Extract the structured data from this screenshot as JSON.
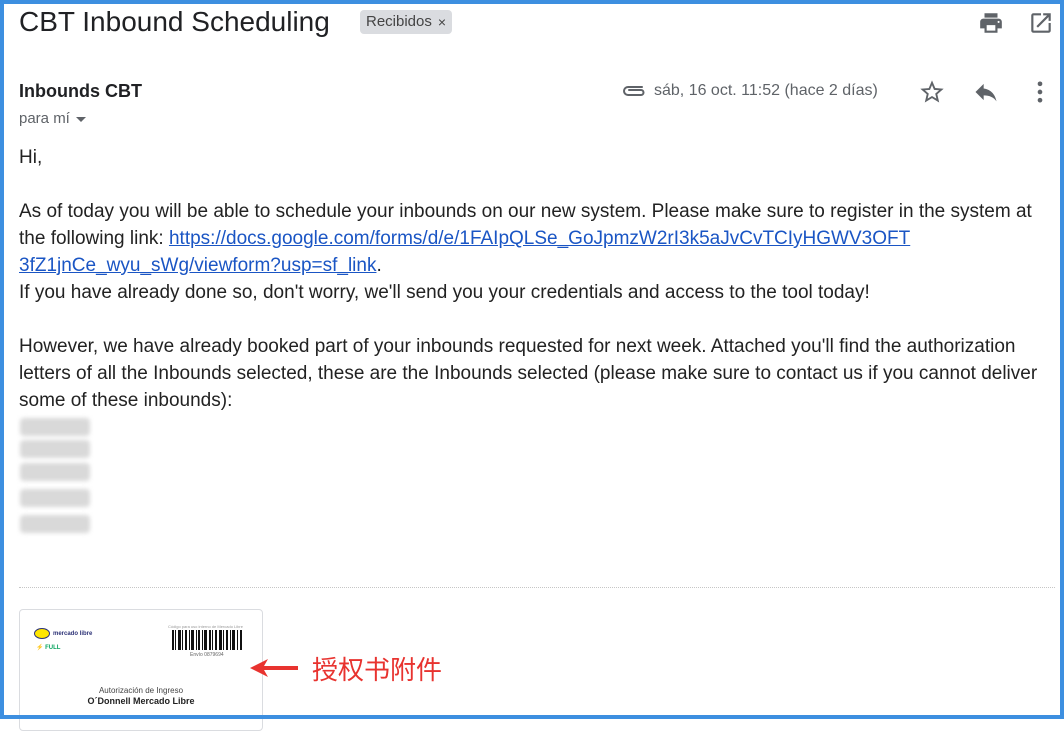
{
  "email": {
    "subject": "CBT Inbound Scheduling",
    "label_chip": "Recibidos",
    "label_chip_close": "×",
    "sender": "Inbounds CBT",
    "recipient": "para mí",
    "date": "sáb, 16 oct. 11:52 (hace 2 días)"
  },
  "body": {
    "greeting": "Hi,",
    "p1_before_link": "As of today you will be able to schedule your inbounds on our new system. Please make sure to register in the system at the following link: ",
    "link_line1": "https://docs.google.com/forms/d/e/1FAIpQLSe_GoJpmzW2rI3k5aJvCvTCIyHGWV3OFT",
    "link_line2": "3fZ1jnCe_wyu_sWg/viewform?usp=sf_link",
    "p1_after_link": ".",
    "p2": "If you have already done so, don't worry, we'll send you your credentials and access to the tool today!",
    "p3": "However, we have already booked part of your inbounds requested for next week. Attached you'll find the authorization letters of all the Inbounds selected, these are the Inbounds selected (please make sure to contact us if you cannot deliver some of these inbounds):"
  },
  "attachment": {
    "logo_text": "mercado libre",
    "full_tag": "FULL",
    "barcode_caption": "Código para uso interno de Mercado Libre",
    "barcode_number": "Envío 0879694",
    "auth_title": "Autorización de Ingreso",
    "auth_company": "O´Donnell Mercado Libre"
  },
  "annotation": {
    "text": "授权书附件",
    "color": "#e8332f"
  },
  "icons": {
    "print": "print-icon",
    "open_new_window": "open-in-new-window-icon",
    "attachment": "paperclip-icon",
    "star": "star-icon",
    "reply": "reply-icon",
    "more": "more-vertical-icon"
  },
  "colors": {
    "frame_border": "#3d8fe0",
    "link": "#1a55c4"
  }
}
